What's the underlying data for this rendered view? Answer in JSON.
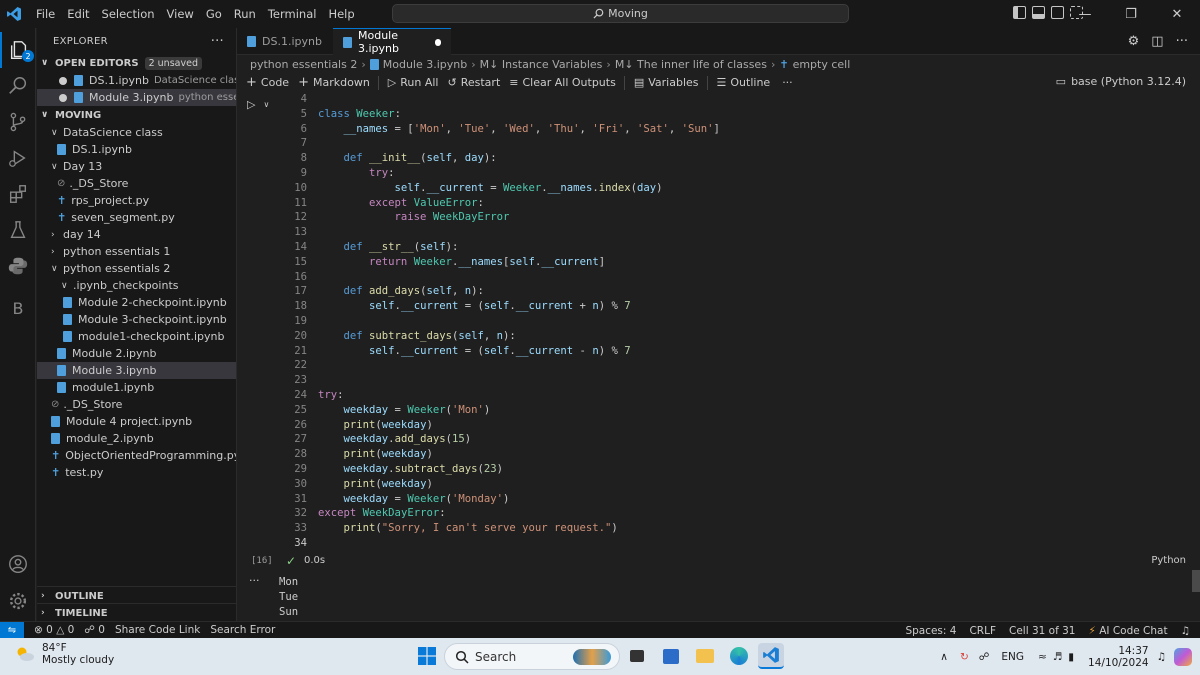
{
  "titlebar": {
    "menu": [
      "File",
      "Edit",
      "Selection",
      "View",
      "Go",
      "Run",
      "Terminal",
      "Help"
    ],
    "command_center": "Moving"
  },
  "activity": {
    "badge": "2",
    "letter": "B"
  },
  "explorer": {
    "title": "EXPLORER",
    "open_editors_label": "OPEN EDITORS",
    "unsaved": "2 unsaved",
    "open_editors": [
      {
        "name": "DS.1.ipynb",
        "desc": "DataScience class"
      },
      {
        "name": "Module 3.ipynb",
        "desc": "python essential..."
      }
    ],
    "folder_label": "MOVING",
    "tree": [
      {
        "label": "DataScience class"
      },
      {
        "label": "DS.1.ipynb"
      },
      {
        "label": "Day 13"
      },
      {
        "label": "._DS_Store"
      },
      {
        "label": "rps_project.py"
      },
      {
        "label": "seven_segment.py"
      },
      {
        "label": "day 14"
      },
      {
        "label": "python essentials 1"
      },
      {
        "label": "python essentials 2"
      },
      {
        "label": ".ipynb_checkpoints"
      },
      {
        "label": "Module 2-checkpoint.ipynb"
      },
      {
        "label": "Module 3-checkpoint.ipynb"
      },
      {
        "label": "module1-checkpoint.ipynb"
      },
      {
        "label": "Module 2.ipynb"
      },
      {
        "label": "Module 3.ipynb"
      },
      {
        "label": "module1.ipynb"
      },
      {
        "label": "._DS_Store"
      },
      {
        "label": "Module 4 project.ipynb"
      },
      {
        "label": "module_2.ipynb"
      },
      {
        "label": "ObjectOrientedProgramming.py"
      },
      {
        "label": "test.py"
      }
    ],
    "outline_label": "OUTLINE",
    "timeline_label": "TIMELINE"
  },
  "tabs": [
    {
      "label": "DS.1.ipynb"
    },
    {
      "label": "Module 3.ipynb"
    }
  ],
  "breadcrumbs": [
    "python essentials 2",
    "Module 3.ipynb",
    "M↓ Instance Variables",
    "M↓ The inner life of classes",
    "empty cell"
  ],
  "toolbar": {
    "code": "Code",
    "markdown": "Markdown",
    "run_all": "Run All",
    "restart": "Restart",
    "clear": "Clear All Outputs",
    "variables": "Variables",
    "outline": "Outline",
    "kernel": "base (Python 3.12.4)"
  },
  "cell": {
    "first_line": 4,
    "exec_count": "[16]",
    "time": "0.0s",
    "language": "Python",
    "lines": [
      "",
      "class Weeker:",
      "    __names = ['Mon', 'Tue', 'Wed', 'Thu', 'Fri', 'Sat', 'Sun']",
      "",
      "    def __init__(self, day):",
      "        try:",
      "            self.__current = Weeker.__names.index(day)",
      "        except ValueError:",
      "            raise WeekDayError",
      "",
      "    def __str__(self):",
      "        return Weeker.__names[self.__current]",
      "",
      "    def add_days(self, n):",
      "        self.__current = (self.__current + n) % 7",
      "",
      "    def subtract_days(self, n):",
      "        self.__current = (self.__current - n) % 7",
      "",
      "",
      "try:",
      "    weekday = Weeker('Mon')",
      "    print(weekday)",
      "    weekday.add_days(15)",
      "    print(weekday)",
      "    weekday.subtract_days(23)",
      "    print(weekday)",
      "    weekday = Weeker('Monday')",
      "except WeekDayError:",
      "    print(\"Sorry, I can't serve your request.\")",
      ""
    ]
  },
  "output": [
    "Mon",
    "Tue",
    "Sun"
  ],
  "statusbar": {
    "errors": "0",
    "warnings": "0",
    "ports": "0",
    "share": "Share Code Link",
    "search_error": "Search Error",
    "spaces": "Spaces: 4",
    "eol": "CRLF",
    "cell": "Cell 31 of 31",
    "ai": "AI Code Chat"
  },
  "taskbar": {
    "temp": "84°F",
    "weather": "Mostly cloudy",
    "search": "Search",
    "lang": "ENG",
    "time": "14:37",
    "date": "14/10/2024"
  }
}
